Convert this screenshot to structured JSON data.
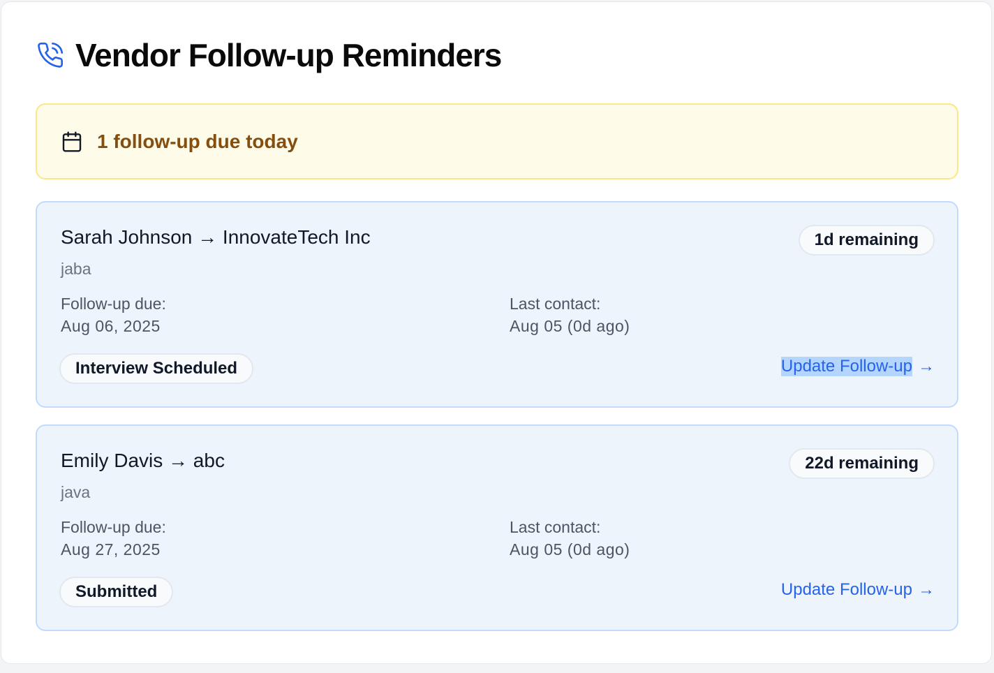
{
  "header": {
    "title": "Vendor Follow-up Reminders",
    "icon": "phone-icon"
  },
  "alert": {
    "text": "1 follow-up due today",
    "icon": "calendar-icon"
  },
  "labels": {
    "followup_due": "Follow-up due:",
    "last_contact": "Last contact:",
    "update_action": "Update Follow-up",
    "arrow": "→"
  },
  "colors": {
    "accent": "#2563eb",
    "alert_bg": "#fefce8",
    "alert_text": "#854d0e",
    "card_bg": "#eef4fc"
  },
  "cards": [
    {
      "candidate": "Sarah Johnson",
      "vendor": "InnovateTech Inc",
      "title": "Sarah Johnson → InnovateTech Inc",
      "sub": "jaba",
      "remaining": "1d remaining",
      "followup_date": "Aug 06, 2025",
      "last_contact": "Aug 05 (0d ago)",
      "status": "Interview Scheduled"
    },
    {
      "candidate": "Emily Davis",
      "vendor": "abc",
      "title": "Emily Davis → abc",
      "sub": "java",
      "remaining": "22d remaining",
      "followup_date": "Aug 27, 2025",
      "last_contact": "Aug 05 (0d ago)",
      "status": "Submitted"
    }
  ]
}
